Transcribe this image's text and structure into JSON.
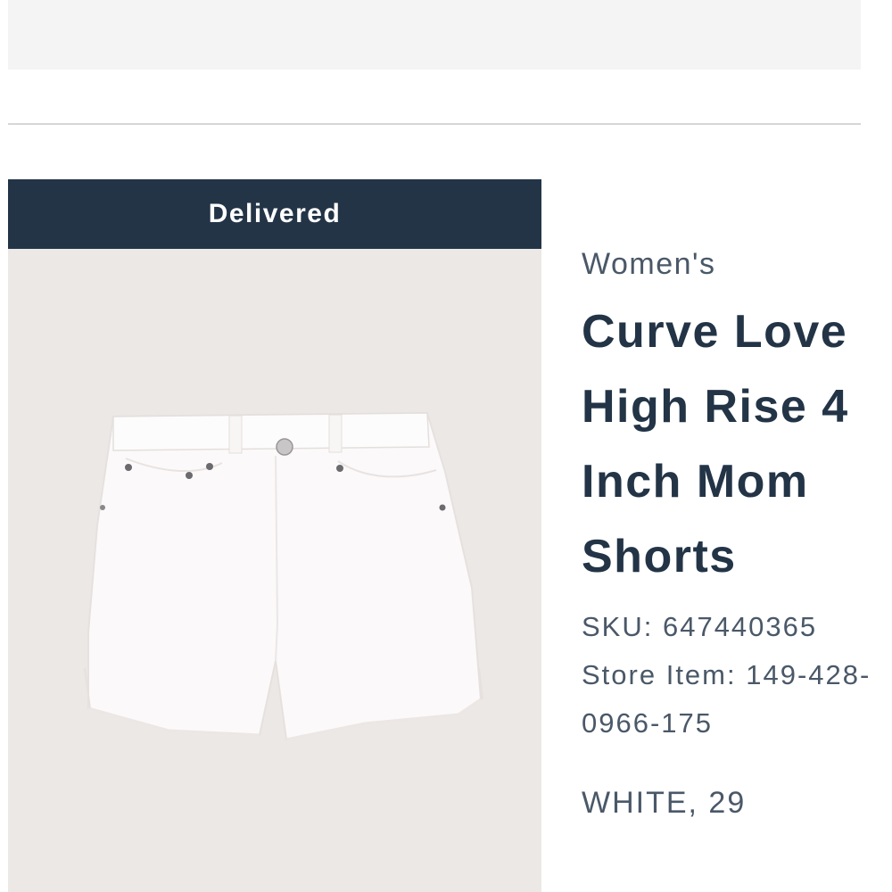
{
  "order_item": {
    "status": "Delivered",
    "image_alt": "White denim shorts",
    "gender": "Women's",
    "title": "Curve Love High Rise 4 Inch Mom Shorts",
    "sku_label": "SKU: 647440365",
    "store_item_label": "Store Item: 149-428-0966-175",
    "variant": "WHITE, 29"
  },
  "colors": {
    "status_bar": "#233447",
    "image_background": "#ebe8e5",
    "banner": "#f4f4f4",
    "text_primary": "#233447",
    "text_secondary": "#4a5868"
  }
}
